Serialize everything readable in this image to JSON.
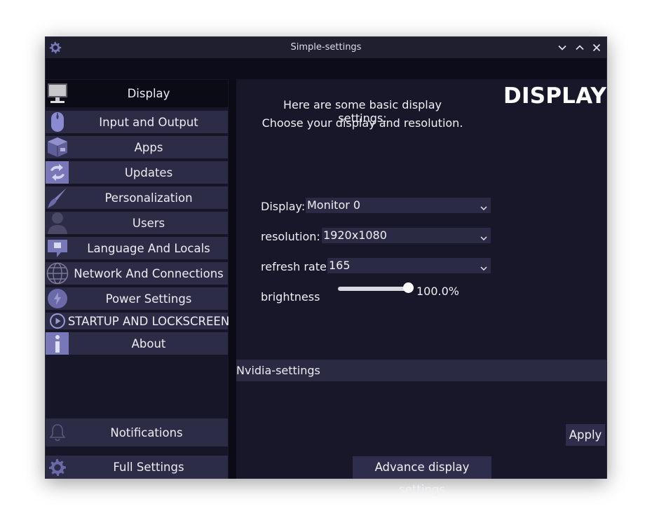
{
  "window": {
    "title": "Simple-settings"
  },
  "sidebar": {
    "items": [
      {
        "label": "Display",
        "icon": "monitor-icon",
        "active": true
      },
      {
        "label": "Input and Output",
        "icon": "mouse-icon"
      },
      {
        "label": "Apps",
        "icon": "package-icon"
      },
      {
        "label": "Updates",
        "icon": "refresh-icon"
      },
      {
        "label": "Personalization",
        "icon": "brush-icon"
      },
      {
        "label": "Users",
        "icon": "user-icon"
      },
      {
        "label": "Language And Locals",
        "icon": "chat-icon"
      },
      {
        "label": "Network And Connections",
        "icon": "globe-icon"
      },
      {
        "label": "Power Settings",
        "icon": "power-icon"
      },
      {
        "label": "STARTUP AND LOCKSCREEN",
        "icon": "play-circle-icon"
      },
      {
        "label": "About",
        "icon": "info-icon"
      }
    ],
    "notifications_label": "Notifications",
    "full_settings_label": "Full Settings"
  },
  "main": {
    "title": "DISPLAY",
    "intro_line1": "Here are some basic display settings:",
    "intro_line2": "Choose your display and resolution.",
    "display_label": "Display:",
    "display_value": "Monitor 0",
    "resolution_label": "resolution:",
    "resolution_value": "1920x1080",
    "refresh_label": "refresh rate",
    "refresh_value": "165",
    "brightness_label": "brightness",
    "brightness_value": "100.0%",
    "brightness_level": 1.0,
    "nvidia_label": "Nvidia-settings",
    "apply_label": "Apply",
    "advance_label": "Advance display settings"
  },
  "colors": {
    "accent": "#7878b8",
    "background": "#171729",
    "sidebar_item": "#2c2c46",
    "active_item": "#0b0b15"
  }
}
